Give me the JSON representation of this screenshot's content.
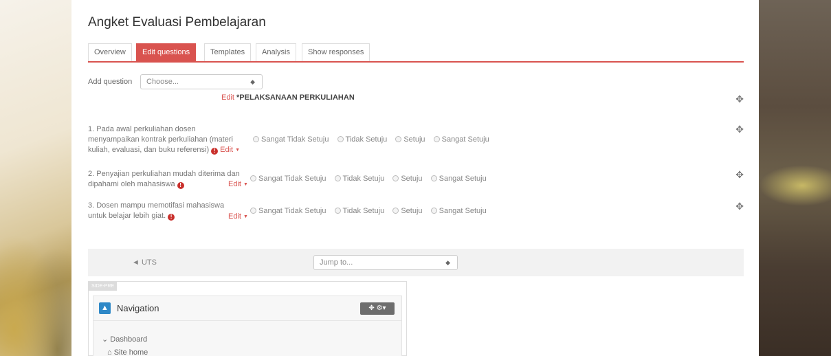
{
  "page": {
    "title": "Angket Evaluasi Pembelajaran"
  },
  "tabs": [
    {
      "label": "Overview"
    },
    {
      "label": "Edit questions"
    },
    {
      "label": "Templates"
    },
    {
      "label": "Analysis"
    },
    {
      "label": "Show responses"
    }
  ],
  "add_question": {
    "label": "Add question",
    "value": "Choose..."
  },
  "section": {
    "edit_label": "Edit",
    "title": "*PELAKSANAAN PERKULIAHAN"
  },
  "options": [
    "Sangat Tidak Setuju",
    "Tidak Setuju",
    "Setuju",
    "Sangat Setuju"
  ],
  "questions": [
    {
      "line1": "1. Pada awal perkuliahan dosen",
      "line2": "menyampaikan kontrak perkuliahan (materi",
      "line3": "kuliah, evaluasi, dan buku referensi)",
      "edit_label": "Edit"
    },
    {
      "line1": "2. Penyajian perkuliahan mudah diterima dan",
      "line2": "dipahami oleh mahasiswa",
      "edit_label": "Edit"
    },
    {
      "line1": "3. Dosen mampu memotifasi mahasiswa",
      "line2": "untuk belajar lebih giat.",
      "edit_label": "Edit"
    }
  ],
  "activity_nav": {
    "prev_label": "◄ UTS",
    "jump_placeholder": "Jump to..."
  },
  "block": {
    "region_label": "SIDE-PRE",
    "title": "Navigation",
    "items": [
      "Dashboard",
      "Site home"
    ]
  },
  "colors": {
    "accent": "#d9534f",
    "nav_icon": "#2e88c7"
  },
  "icons": {
    "required": "exclamation-circle-icon",
    "move": "move-arrows-icon",
    "gear": "gear-icon",
    "home": "home-icon"
  }
}
